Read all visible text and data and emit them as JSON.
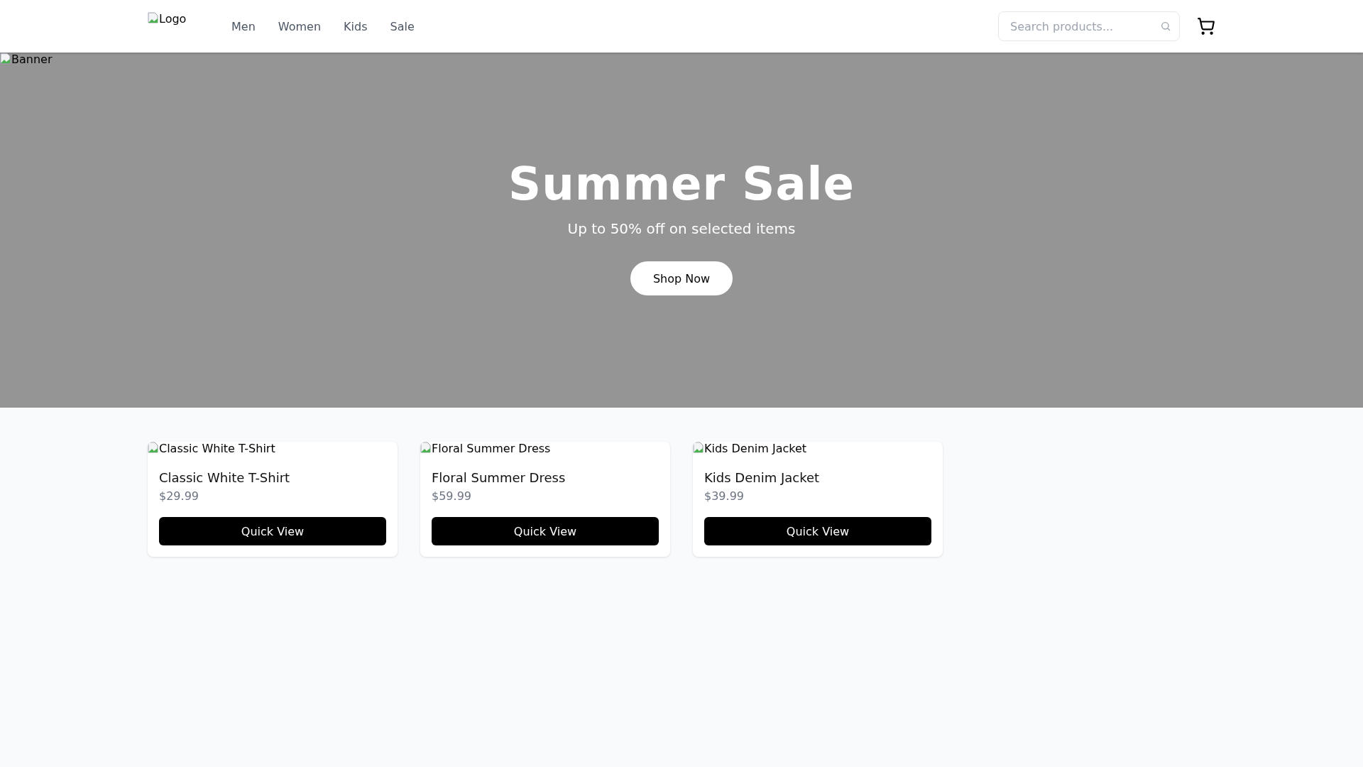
{
  "header": {
    "logo_alt": "Logo",
    "nav": [
      "Men",
      "Women",
      "Kids",
      "Sale"
    ],
    "search": {
      "placeholder": "Search products..."
    }
  },
  "banner": {
    "image_alt": "Banner",
    "title": "Summer Sale",
    "subtitle": "Up to 50% off on selected items",
    "button": "Shop Now"
  },
  "products": [
    {
      "image_alt": "Classic White T-Shirt",
      "name": "Classic White T-Shirt",
      "price": "$29.99",
      "button": "Quick View"
    },
    {
      "image_alt": "Floral Summer Dress",
      "name": "Floral Summer Dress",
      "price": "$59.99",
      "button": "Quick View"
    },
    {
      "image_alt": "Kids Denim Jacket",
      "name": "Kids Denim Jacket",
      "price": "$39.99",
      "button": "Quick View"
    }
  ]
}
